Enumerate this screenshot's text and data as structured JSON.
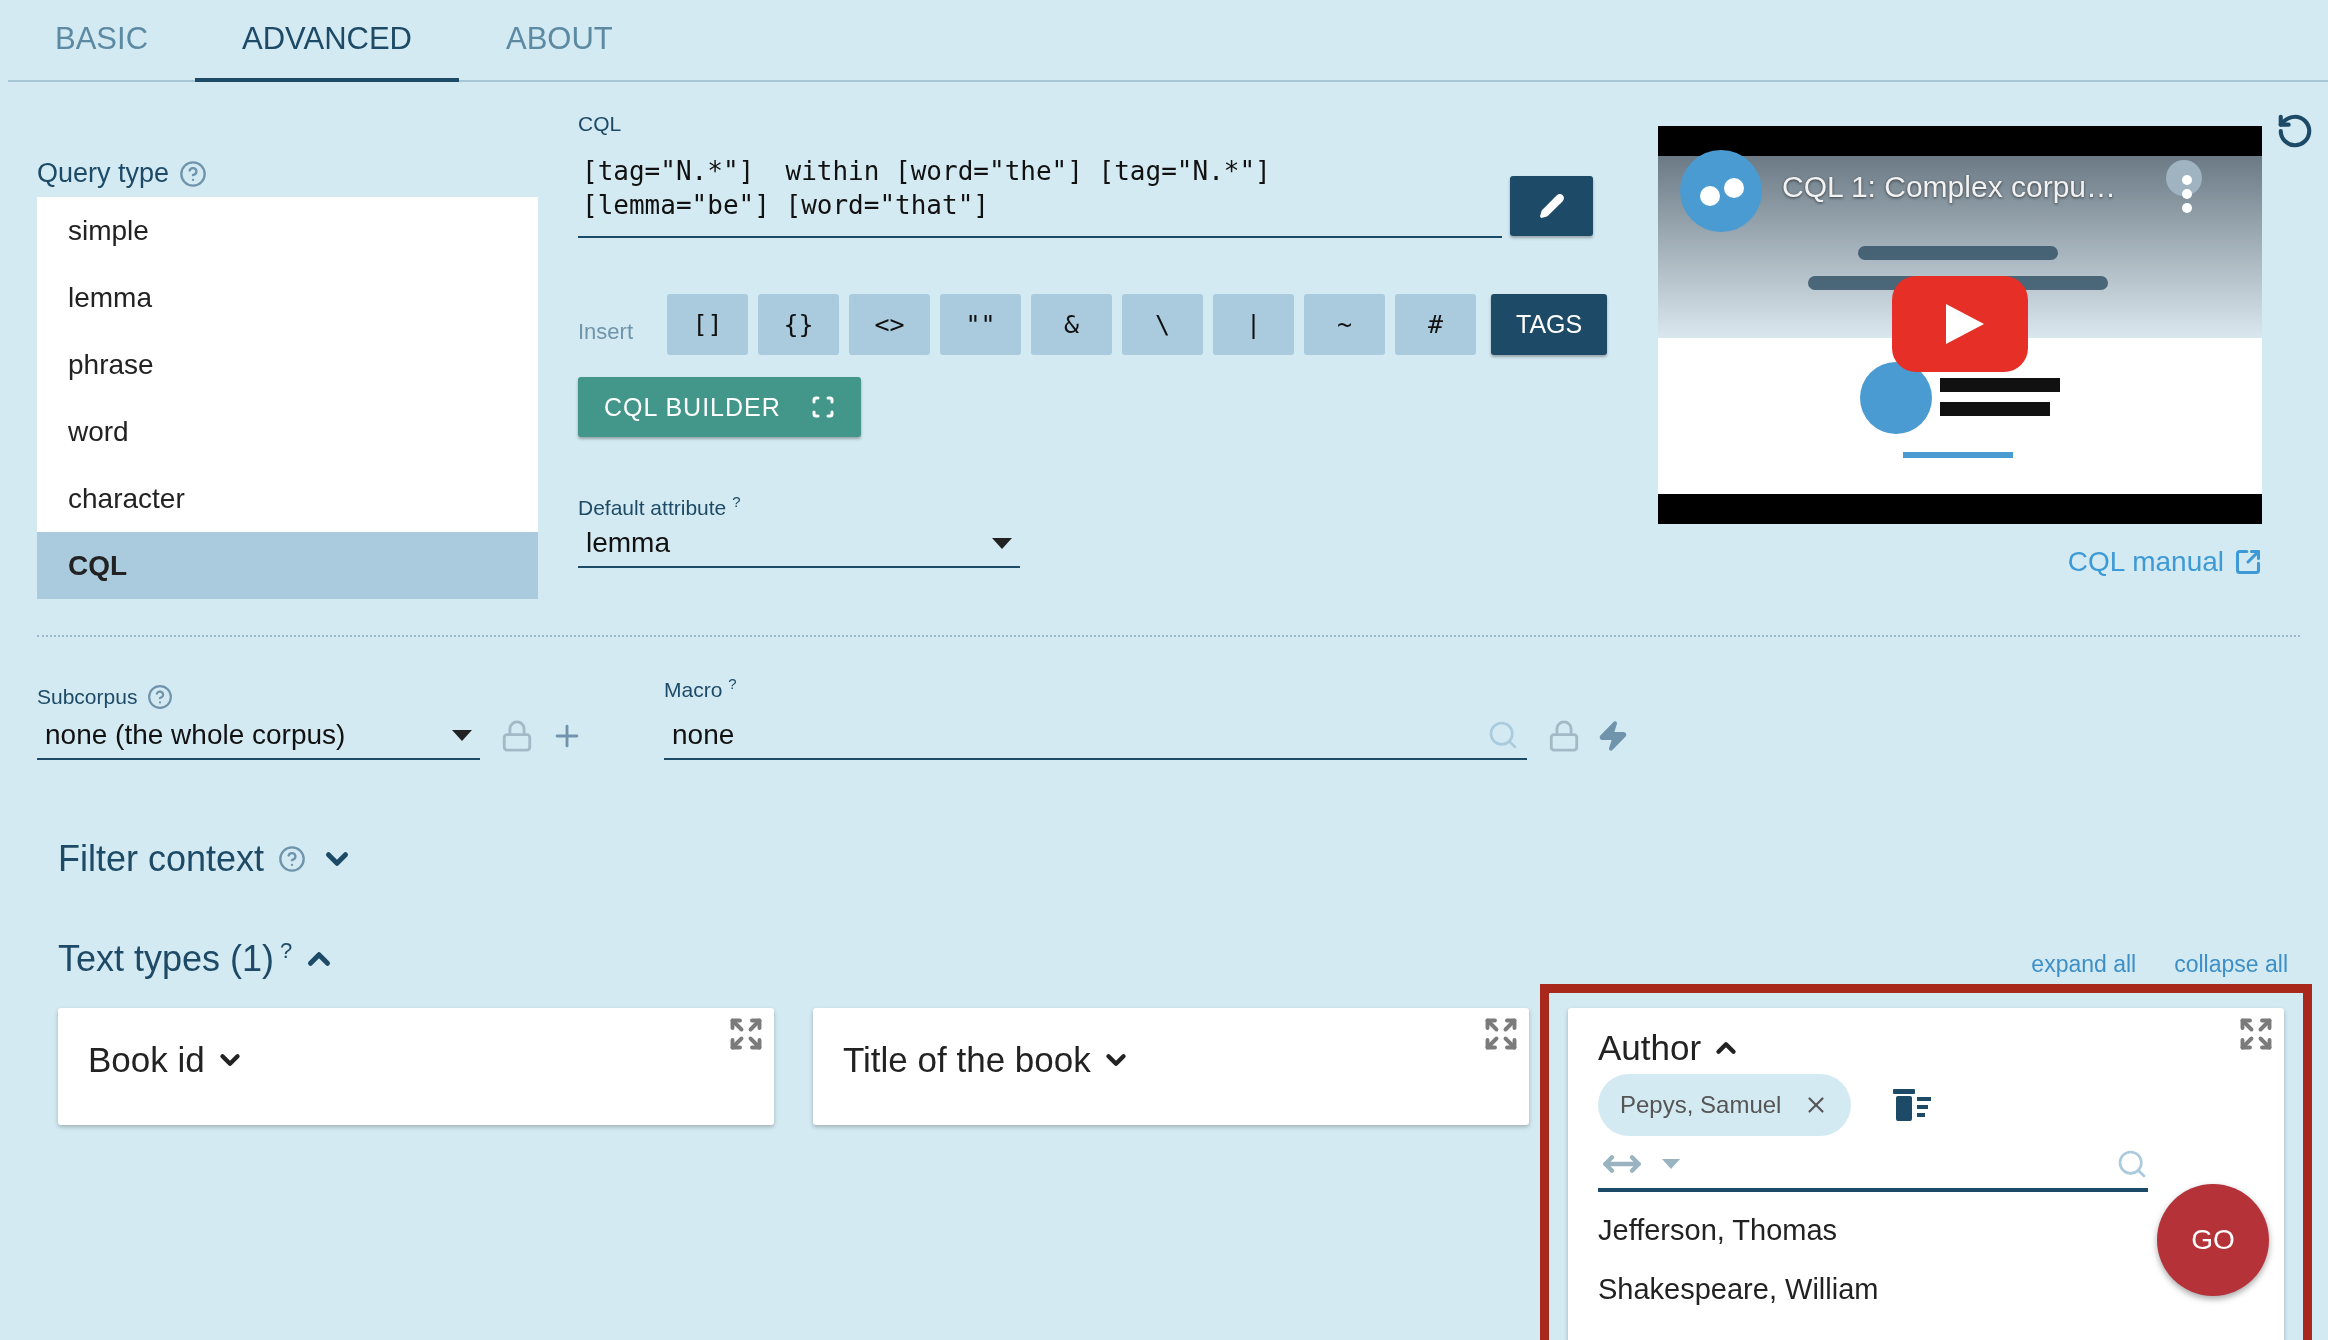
{
  "tabs": [
    {
      "label": "BASIC",
      "selected": false
    },
    {
      "label": "ADVANCED",
      "selected": true
    },
    {
      "label": "ABOUT",
      "selected": false
    }
  ],
  "query_type": {
    "label": "Query type",
    "options": [
      {
        "label": "simple",
        "selected": false
      },
      {
        "label": "lemma",
        "selected": false
      },
      {
        "label": "phrase",
        "selected": false
      },
      {
        "label": "word",
        "selected": false
      },
      {
        "label": "character",
        "selected": false
      },
      {
        "label": "CQL",
        "selected": true
      }
    ]
  },
  "cql": {
    "label": "CQL",
    "lines": [
      "[tag=\"N.*\"]  within [word=\"the\"] [tag=\"N.*\"]",
      "[lemma=\"be\"] [word=\"that\"]"
    ]
  },
  "insert": {
    "label": "Insert",
    "keys": [
      "[]",
      "{}",
      "<>",
      "\"\"",
      "&",
      "\\",
      "|",
      "~",
      "#"
    ],
    "tags_button": "TAGS"
  },
  "cql_builder": "CQL BUILDER",
  "default_attribute": {
    "label": "Default attribute",
    "hint": "?",
    "value": "lemma"
  },
  "video": {
    "title": "CQL 1: Complex corpu…"
  },
  "cql_manual": "CQL manual",
  "subcorpus": {
    "label": "Subcorpus",
    "value": "none (the whole corpus)"
  },
  "macro": {
    "label": "Macro",
    "hint": "?",
    "value": "none"
  },
  "filter_context": {
    "title": "Filter context",
    "expanded": false
  },
  "text_types": {
    "title": "Text types (1)",
    "hint": "?",
    "expanded": true,
    "expand_all": "expand all",
    "collapse_all": "collapse all",
    "cards": [
      {
        "title": "Book id",
        "expanded": false,
        "highlighted": false
      },
      {
        "title": "Title of the book",
        "expanded": false,
        "highlighted": false
      },
      {
        "title": "Author",
        "expanded": true,
        "highlighted": true,
        "chips": [
          "Pepys, Samuel"
        ],
        "options": [
          "Jefferson, Thomas",
          "Shakespeare, William"
        ]
      }
    ]
  },
  "go_button": "GO"
}
